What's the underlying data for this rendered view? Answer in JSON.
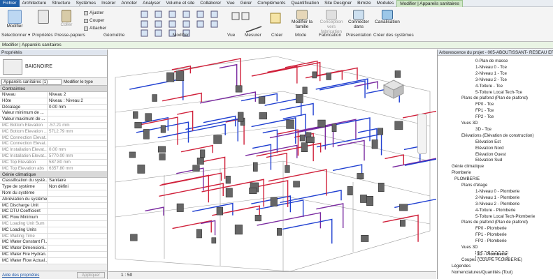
{
  "tabs": [
    "Fichier",
    "Architecture",
    "Structure",
    "Systèmes",
    "Insérer",
    "Annoter",
    "Analyser",
    "Volume et site",
    "Collaborer",
    "Vue",
    "Gérer",
    "Compléments",
    "Quantification",
    "Site Designer",
    "Bimize",
    "Modules",
    "Modifier | Appareils sanitaires"
  ],
  "ribbon": {
    "modify": "Modifier",
    "properties": "Propriétés",
    "paste": "Coller",
    "adjust": "Ajuster",
    "cut": "Couper",
    "attach": "Attacher",
    "modify_family": "Modifier la famille",
    "conception": "Conception vers fabrication",
    "connect": "Connecter dans",
    "canalisation": "Canalisation",
    "panels": [
      "Sélectionner ▾",
      "Propriétés",
      "Presse-papiers",
      "Géométrie",
      "Modifier",
      "Vue",
      "Mesurer",
      "Créer",
      "Mode",
      "Fabrication",
      "Présentation",
      "Créer des systèmes"
    ]
  },
  "context_bar": "Modifier | Appareils sanitaires",
  "props": {
    "title": "Propriétés",
    "type_name": "BAIGNOIRE",
    "selector": "Appareils sanitaires (1)",
    "edit_type": "Modifier le type",
    "contraintes": "Contraintes",
    "rows1": [
      [
        "Niveau",
        "Niveau 2"
      ],
      [
        "Hôte",
        "Niveau : Niveau 2"
      ],
      [
        "Décalage",
        "0.00 mm"
      ],
      [
        "Valeur minimum de ...",
        ""
      ],
      [
        "Valeur maximum de ...",
        ""
      ],
      [
        "MC Bottom Elevation",
        "-57.21 mm"
      ],
      [
        "MC Bottom Elevation ...",
        "5712.79 mm"
      ],
      [
        "MC Connection Elevat...",
        ""
      ],
      [
        "MC Connection Elevat...",
        ""
      ],
      [
        "MC Installation Elevat...",
        "0.00 mm"
      ],
      [
        "MC Installation Elevat...",
        "5770.00 mm"
      ],
      [
        "MC Top Elevation",
        "587.80 mm"
      ],
      [
        "MC Top Elevation abs",
        "6357.80 mm"
      ]
    ],
    "genie": "Génie climatique",
    "rows2": [
      [
        "Classification du systè...",
        "Sanitaire"
      ],
      [
        "Type de système",
        "Non défini"
      ],
      [
        "Nom du système",
        ""
      ],
      [
        "Abréviation du système",
        ""
      ],
      [
        "MC Discharge Unit",
        ""
      ],
      [
        "MC DTU Coefficient",
        ""
      ],
      [
        "MC Flow Minimum",
        ""
      ],
      [
        "MC Loading Unit Sum",
        ""
      ],
      [
        "MC Loading Units",
        ""
      ],
      [
        "MC Waiting Time",
        ""
      ],
      [
        "MC Water Constant Fl...",
        ""
      ],
      [
        "MC Water Dimensioni...",
        ""
      ],
      [
        "MC Water Fire Hydran...",
        ""
      ],
      [
        "MC Water Flow Actual...",
        ""
      ]
    ],
    "help": "Aide des propriétés",
    "apply": "Appliquer"
  },
  "view": {
    "scale": "1 : 50"
  },
  "tree": {
    "title": "Arborescence du projet - 005-ABOUTISSANT- RESEAU EFS ...",
    "items": [
      "0-Plan de masse",
      "1-Niveau 0 - Tce",
      "2-Niveau 1 - Tce",
      "3-Niveau 2 - Tce",
      "4-Toiture - Tce",
      "5-Toiture Local Tech-Tce",
      "Plans de plafond (Plan de plafond)",
      "FP0 - Tce",
      "FP1 - Tce",
      "FP2 - Tce",
      "Vues 3D",
      "3D - Tce",
      "Elévations (Elévation de construction)",
      "Elévation Est",
      "Elévation Nord",
      "Elévation Ouest",
      "Elévation Sud",
      "Génie climatique",
      "Plomberie",
      "PLOMBERIE",
      "Plans d'étage",
      "1-Niveau 0 - Plomberie",
      "2-Niveau 1 - Plomberie",
      "3-Niveau 2 - Plomberie",
      "4-Toiture - Plomberie",
      "5-Toiture Local Tech-Plomberie",
      "Plans de plafond (Plan de plafond)",
      "FP0 - Plomberie",
      "FP1 - Plomberie",
      "FP2 - Plomberie",
      "Vues 3D",
      "3D - Plomberie",
      "Coupes (COUPE PLOMBERIE)",
      "Légendes",
      "Nomenclatures/Quantités (Tout)"
    ]
  }
}
